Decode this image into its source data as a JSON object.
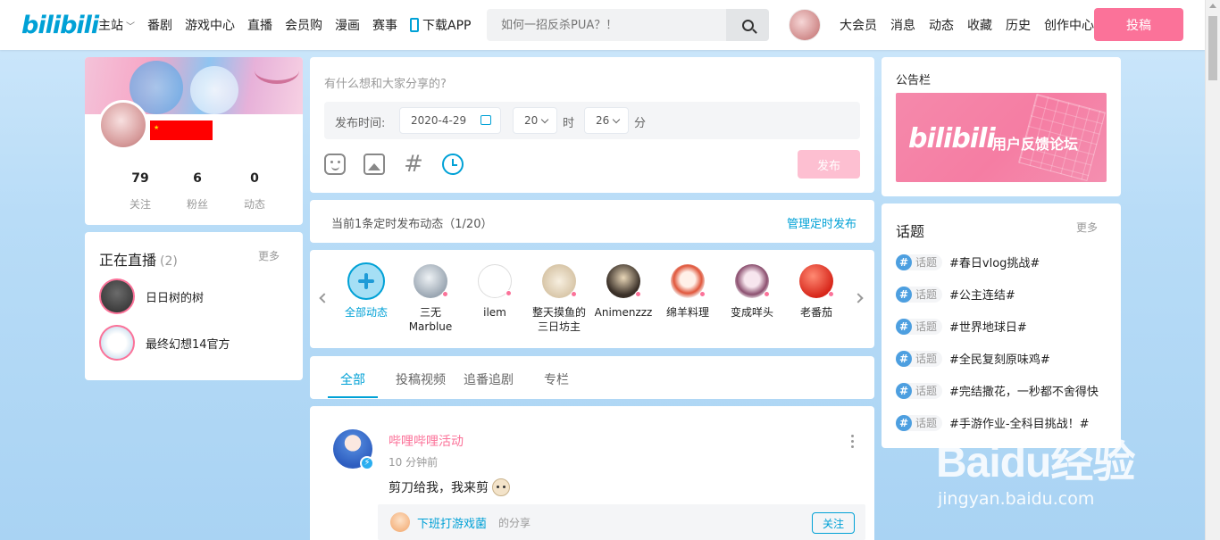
{
  "logo": "bilibili",
  "nav_left": [
    "主站",
    "番剧",
    "游戏中心",
    "直播",
    "会员购",
    "漫画",
    "赛事",
    "下载APP"
  ],
  "search": {
    "placeholder": "如何一招反杀PUA？！"
  },
  "nav_right": [
    "大会员",
    "消息",
    "动态",
    "收藏",
    "历史",
    "创作中心"
  ],
  "upload_label": "投稿",
  "profile": {
    "stats": [
      {
        "num": "79",
        "label": "关注"
      },
      {
        "num": "6",
        "label": "粉丝"
      },
      {
        "num": "0",
        "label": "动态"
      }
    ]
  },
  "live": {
    "title": "正在直播",
    "count": "(2)",
    "more": "更多",
    "items": [
      "日日树的树",
      "最终幻想14官方"
    ]
  },
  "composer": {
    "placeholder": "有什么想和大家分享的?",
    "time_label": "发布时间:",
    "date": "2020-4-29",
    "hour": "20",
    "hour_unit": "时",
    "minute": "26",
    "minute_unit": "分",
    "publish": "发布"
  },
  "scheduled": {
    "text": "当前1条定时发布动态（1/20）",
    "manage": "管理定时发布"
  },
  "following": [
    "全部动态",
    "三无\nMarblue",
    "ilem",
    "整天摸鱼的\n三日坊主",
    "Animenzzz",
    "绵羊料理",
    "变成咩头",
    "老番茄"
  ],
  "tabs": [
    "全部",
    "投稿视频",
    "追番追剧",
    "专栏"
  ],
  "feed": {
    "user": "哔哩哔哩活动",
    "time": "10 分钟前",
    "content": "剪刀给我，我来剪",
    "share_user": "下班打游戏菌",
    "share_suffix": "的分享",
    "follow_label": "关注"
  },
  "notice": {
    "title": "公告栏",
    "banner_logo": "bilibili",
    "banner_text": "用户反馈论坛"
  },
  "topics": {
    "title": "话题",
    "more": "更多",
    "badge": "话题",
    "items": [
      "#春日vlog挑战#",
      "#公主连结#",
      "#世界地球日#",
      "#全民复刻原味鸡#",
      "#完结撒花，一秒都不舍得快",
      "#手游作业-全科目挑战！#"
    ]
  },
  "watermark": {
    "brand": "Baidu经验",
    "url": "jingyan.baidu.com"
  },
  "colors": {
    "accent": "#00a1d6",
    "pink": "#fb7299"
  }
}
